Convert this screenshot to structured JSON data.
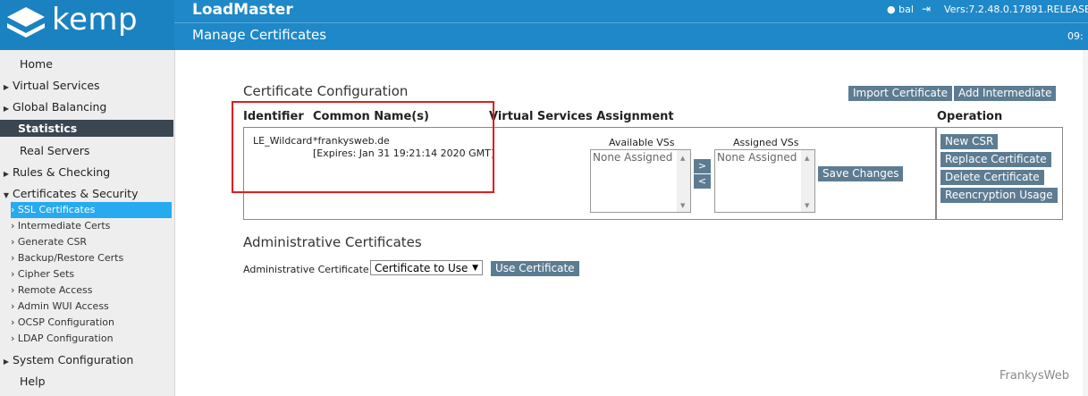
{
  "header": {
    "logo_text": "kemp",
    "app_title": "LoadMaster",
    "page_title": "Manage Certificates",
    "user": "bal",
    "version": "Vers:7.2.48.0.17891.RELEASE (",
    "clock": "09:"
  },
  "sidebar": {
    "home": "Home",
    "virtual_services": "Virtual Services",
    "global_balancing": "Global Balancing",
    "statistics": "Statistics",
    "real_servers": "Real Servers",
    "rules_checking": "Rules & Checking",
    "certs_security": "Certificates & Security",
    "sub_items": [
      "› SSL Certificates",
      "› Intermediate Certs",
      "› Generate CSR",
      "› Backup/Restore Certs",
      "› Cipher Sets",
      "› Remote Access",
      "› Admin WUI Access",
      "› OCSP Configuration",
      "› LDAP Configuration"
    ],
    "system_configuration": "System Configuration",
    "help": "Help"
  },
  "cert_config": {
    "title": "Certificate Configuration",
    "import_label": "Import Certificate",
    "add_intermediate_label": "Add Intermediate",
    "columns": {
      "identifier": "Identifier",
      "common_name": "Common Name(s)",
      "vs_assignment": "Virtual Services Assignment",
      "operation": "Operation"
    },
    "row": {
      "identifier": "LE_Wildcard",
      "common_name": "*frankysweb.de",
      "expires": "[Expires: Jan 31 19:21:14 2020 GMT]",
      "available_label": "Available VSs",
      "assigned_label": "Assigned VSs",
      "available_value": "None Assigned",
      "assigned_value": "None Assigned",
      "move_right": ">",
      "move_left": "<",
      "save_label": "Save Changes"
    },
    "operations": [
      "New CSR",
      "Replace Certificate",
      "Delete Certificate",
      "Reencryption Usage"
    ]
  },
  "admin_certs": {
    "title": "Administrative Certificates",
    "label": "Administrative Certificate",
    "select_value": "Certificate to Use",
    "use_label": "Use Certificate"
  },
  "watermark": "FrankysWeb"
}
